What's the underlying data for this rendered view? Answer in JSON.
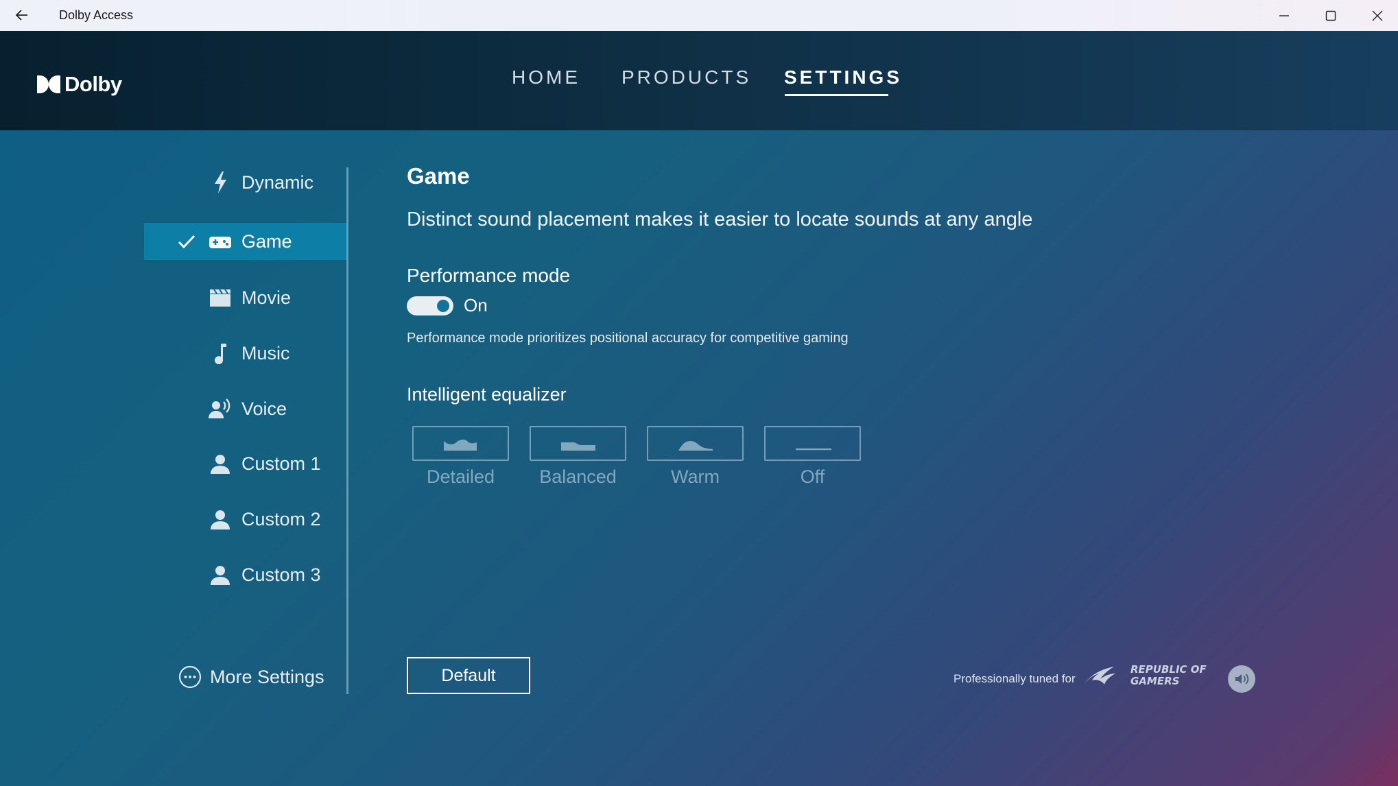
{
  "window": {
    "title": "Dolby Access"
  },
  "header": {
    "brand": "Dolby",
    "nav": [
      {
        "label": "HOME",
        "active": false
      },
      {
        "label": "PRODUCTS",
        "active": false
      },
      {
        "label": "SETTINGS",
        "active": true
      }
    ]
  },
  "sidebar": {
    "items": [
      {
        "label": "Dynamic",
        "icon": "lightning-icon",
        "selected": false
      },
      {
        "label": "Game",
        "icon": "gamepad-icon",
        "selected": true
      },
      {
        "label": "Movie",
        "icon": "clapperboard-icon",
        "selected": false
      },
      {
        "label": "Music",
        "icon": "music-note-icon",
        "selected": false
      },
      {
        "label": "Voice",
        "icon": "voice-icon",
        "selected": false
      },
      {
        "label": "Custom 1",
        "icon": "person-icon",
        "selected": false
      },
      {
        "label": "Custom 2",
        "icon": "person-icon",
        "selected": false
      },
      {
        "label": "Custom 3",
        "icon": "person-icon",
        "selected": false
      }
    ],
    "more_settings": "More Settings"
  },
  "content": {
    "title": "Game",
    "description": "Distinct sound placement makes it easier to locate sounds at any angle",
    "performance": {
      "title": "Performance mode",
      "toggle_on": true,
      "toggle_label": "On",
      "note": "Performance mode prioritizes positional accuracy for competitive gaming"
    },
    "equalizer": {
      "title": "Intelligent equalizer",
      "options": [
        {
          "label": "Detailed",
          "icon": "eq-detailed-icon"
        },
        {
          "label": "Balanced",
          "icon": "eq-balanced-icon"
        },
        {
          "label": "Warm",
          "icon": "eq-warm-icon"
        },
        {
          "label": "Off",
          "icon": "eq-off-icon"
        }
      ]
    },
    "default_button": "Default"
  },
  "footer": {
    "tuned_text": "Professionally tuned for",
    "brand_logo_text": "REPUBLIC OF GAMERS"
  },
  "colors": {
    "active_item": "#0d7ea6",
    "toggle_knob": "#14739a"
  }
}
